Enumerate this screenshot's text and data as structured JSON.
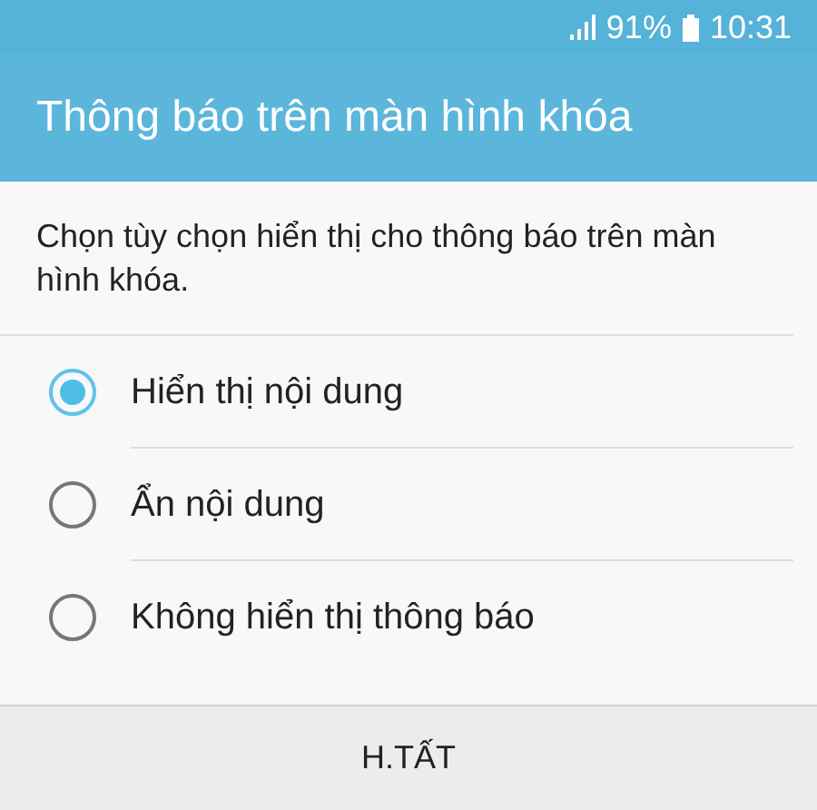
{
  "status_bar": {
    "battery": "91%",
    "time": "10:31"
  },
  "title": "Thông báo trên màn hình khóa",
  "description": "Chọn tùy chọn hiển thị cho thông báo trên màn hình khóa.",
  "options": [
    {
      "label": "Hiển thị nội dung",
      "selected": true
    },
    {
      "label": "Ẩn nội dung",
      "selected": false
    },
    {
      "label": "Không hiển thị thông báo",
      "selected": false
    }
  ],
  "buttons": [
    "H.TẤT"
  ]
}
